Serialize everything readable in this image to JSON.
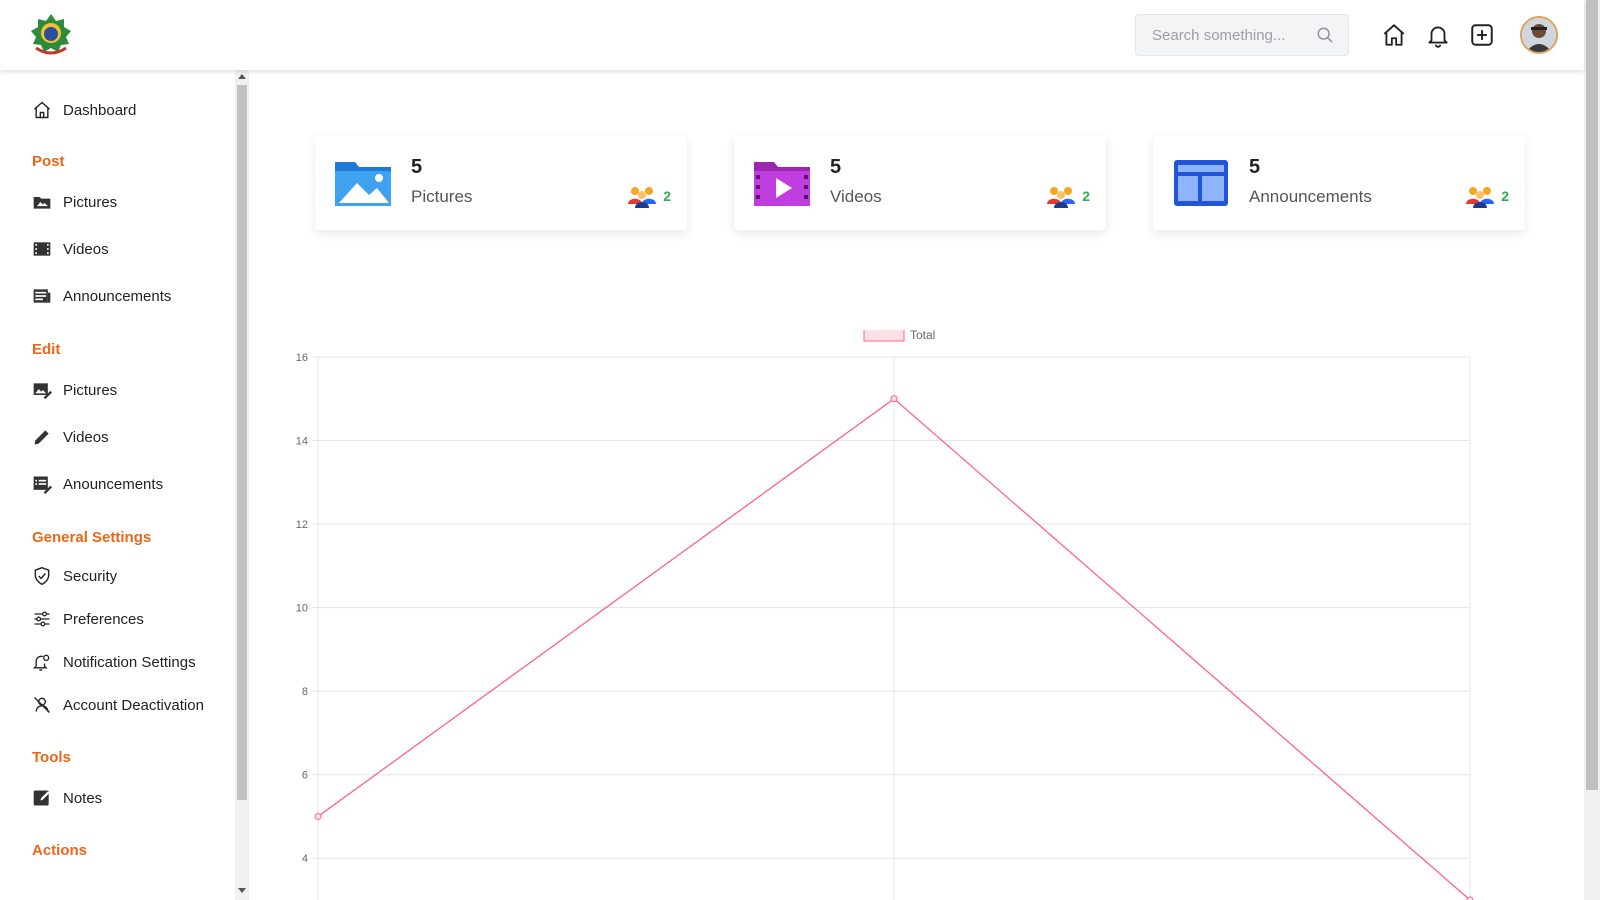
{
  "header": {
    "search_placeholder": "Search something...",
    "icons": [
      "home-icon",
      "bell-icon",
      "plus-square-icon"
    ]
  },
  "sidebar": {
    "dashboard": "Dashboard",
    "sections": {
      "post": "Post",
      "edit": "Edit",
      "general": "General Settings",
      "tools": "Tools",
      "actions": "Actions"
    },
    "post_items": [
      "Pictures",
      "Videos",
      "Announcements"
    ],
    "edit_items": [
      "Pictures",
      "Videos",
      "Anouncements"
    ],
    "general_items": [
      "Security",
      "Preferences",
      "Notification Settings",
      "Account Deactivation"
    ],
    "tools_items": [
      "Notes"
    ]
  },
  "cards": [
    {
      "count": "5",
      "label": "Pictures",
      "users": "2"
    },
    {
      "count": "5",
      "label": "Videos",
      "users": "2"
    },
    {
      "count": "5",
      "label": "Announcements",
      "users": "2"
    }
  ],
  "colors": {
    "accent": "#e8681a",
    "line": "#ff6384",
    "legend_fill": "#ffe0e6",
    "user_count": "#2bb24c"
  },
  "chart_data": {
    "type": "line",
    "series": [
      {
        "name": "Total",
        "values": [
          5,
          15,
          3
        ]
      }
    ],
    "x": [
      "",
      "",
      ""
    ],
    "ylim": [
      3,
      16
    ],
    "yticks": [
      4,
      6,
      8,
      10,
      12,
      14,
      16
    ],
    "grid": true,
    "legend": "top-center"
  }
}
